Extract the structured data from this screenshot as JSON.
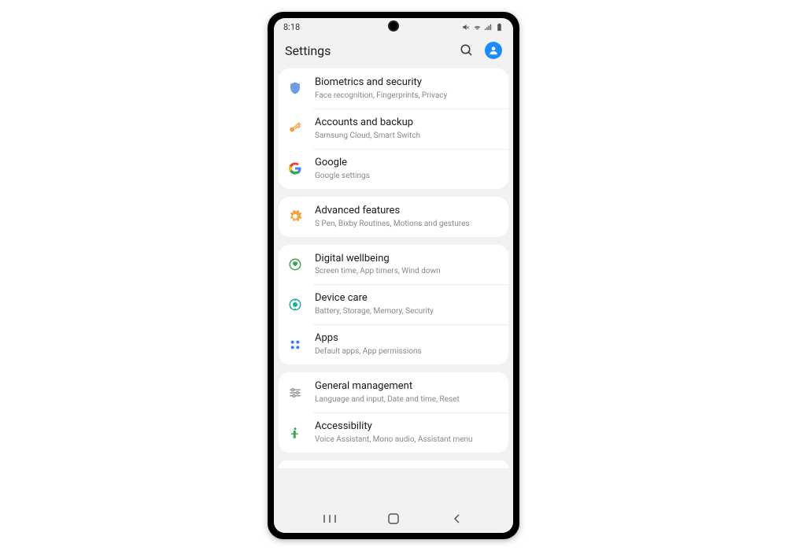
{
  "status": {
    "time": "8:18"
  },
  "header": {
    "title": "Settings"
  },
  "groups": [
    {
      "items": [
        {
          "id": "biometrics",
          "title": "Biometrics and security",
          "sub": "Face recognition, Fingerprints, Privacy",
          "icon": "shield",
          "color": "#6b9de8"
        },
        {
          "id": "accounts",
          "title": "Accounts and backup",
          "sub": "Samsung Cloud, Smart Switch",
          "icon": "key",
          "color": "#f2a33c"
        },
        {
          "id": "google",
          "title": "Google",
          "sub": "Google settings",
          "icon": "google",
          "color": "#4285f4"
        }
      ]
    },
    {
      "items": [
        {
          "id": "advanced",
          "title": "Advanced features",
          "sub": "S Pen, Bixby Routines, Motions and gestures",
          "icon": "gear",
          "color": "#f2a33c"
        }
      ]
    },
    {
      "items": [
        {
          "id": "wellbeing",
          "title": "Digital wellbeing",
          "sub": "Screen time, App timers, Wind down",
          "icon": "wellbeing",
          "color": "#3fa656"
        },
        {
          "id": "devicecare",
          "title": "Device care",
          "sub": "Battery, Storage, Memory, Security",
          "icon": "devicecare",
          "color": "#1aaf9c"
        },
        {
          "id": "apps",
          "title": "Apps",
          "sub": "Default apps, App permissions",
          "icon": "apps",
          "color": "#3f7ef2"
        }
      ]
    },
    {
      "items": [
        {
          "id": "general",
          "title": "General management",
          "sub": "Language and input, Date and time, Reset",
          "icon": "sliders",
          "color": "#999"
        },
        {
          "id": "accessibility",
          "title": "Accessibility",
          "sub": "Voice Assistant, Mono audio, Assistant menu",
          "icon": "person",
          "color": "#3fa656"
        }
      ]
    }
  ]
}
